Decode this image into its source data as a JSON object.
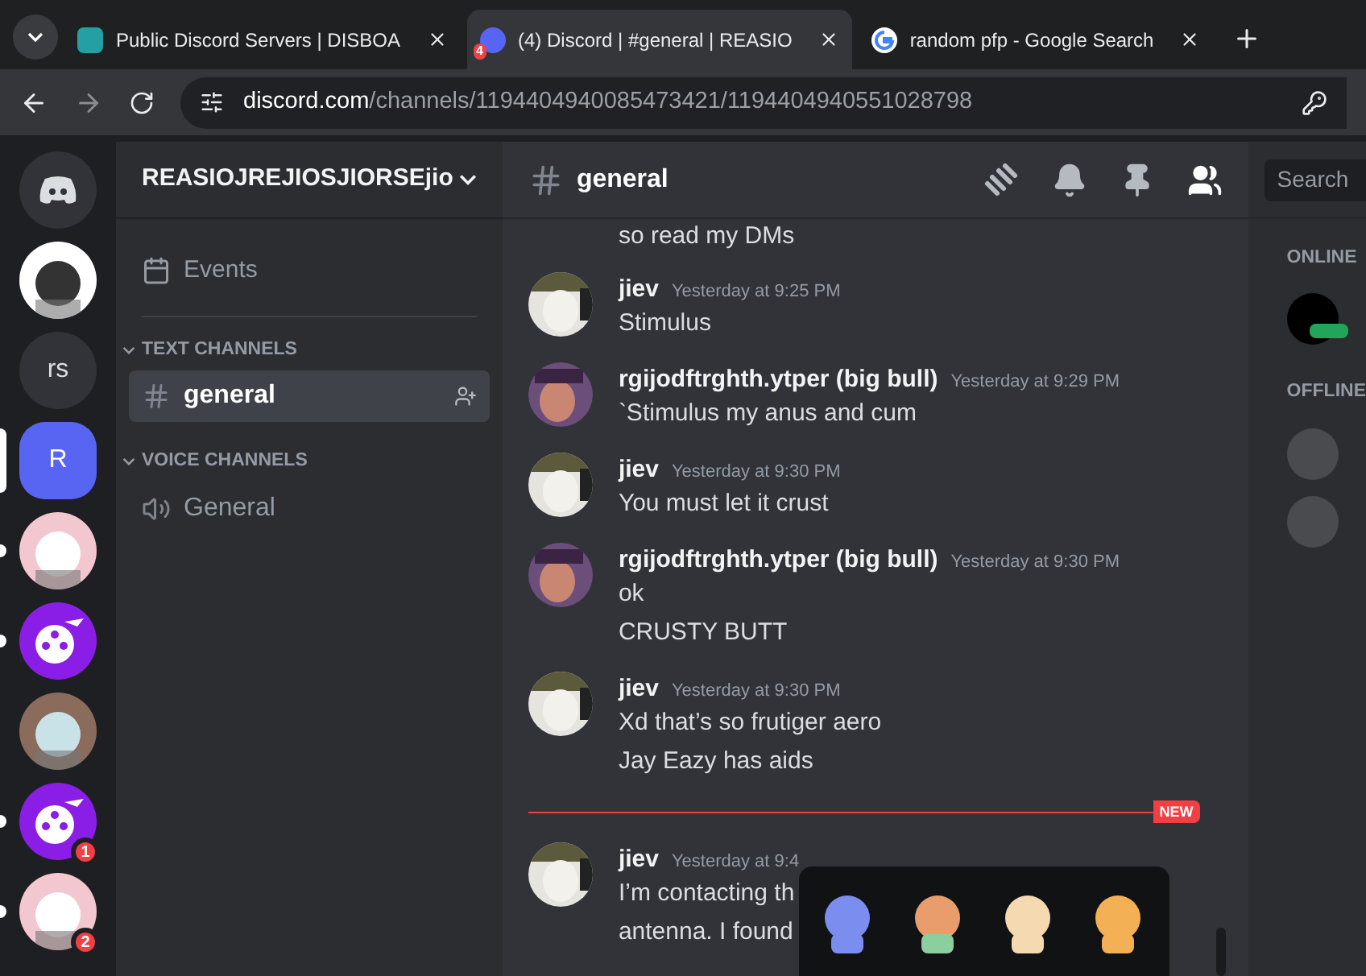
{
  "browser": {
    "tabs": [
      {
        "title": "Public Discord Servers | DISBOA",
        "selected": false
      },
      {
        "title": "(4) Discord | #general | REASIO",
        "badge": "4",
        "selected": true
      },
      {
        "title": "random pfp - Google Search",
        "selected": false
      }
    ],
    "address": {
      "domain": "discord.com",
      "path": "/channels/1194404940085473421/1194404940551028798"
    }
  },
  "servers": [
    {
      "kind": "home",
      "selected": false,
      "unread": false
    },
    {
      "kind": "picture",
      "selected": false,
      "unread": false
    },
    {
      "kind": "text",
      "label": "rs",
      "selected": false,
      "unread": false
    },
    {
      "kind": "text",
      "label": "R",
      "selected": true,
      "unread": false
    },
    {
      "kind": "picture",
      "selected": false,
      "unread": true
    },
    {
      "kind": "reel",
      "selected": false,
      "unread": true
    },
    {
      "kind": "picture",
      "selected": false,
      "unread": false
    },
    {
      "kind": "reel",
      "selected": false,
      "unread": true,
      "badge": "1"
    },
    {
      "kind": "picture",
      "selected": false,
      "unread": true,
      "badge": "2"
    }
  ],
  "server_name": "REASIOJREJIOSJIORSEjio",
  "events": "Events",
  "categories": [
    {
      "title": "TEXT CHANNELS",
      "expanded": true,
      "channels": [
        {
          "kind": "text",
          "name": "general",
          "selected": true
        }
      ]
    },
    {
      "title": "VOICE CHANNELS",
      "expanded": true,
      "channels": [
        {
          "kind": "voice",
          "name": "General",
          "selected": false
        }
      ]
    }
  ],
  "channel": {
    "name": "general",
    "search": {
      "placeholder": "Search"
    }
  },
  "messages": [
    {
      "kind": "continuation",
      "lines": [
        "so read my DMs"
      ]
    },
    {
      "kind": "message",
      "author": "jiev",
      "time": "Yesterday at 9:25 PM",
      "lines": [
        "Stimulus"
      ]
    },
    {
      "kind": "message",
      "author": "rgijodftrghth.ytper (big bull)",
      "time": "Yesterday at 9:29 PM",
      "lines": [
        "`Stimulus my anus and cum"
      ]
    },
    {
      "kind": "message",
      "author": "jiev",
      "time": "Yesterday at 9:30 PM",
      "lines": [
        "You must let it crust"
      ]
    },
    {
      "kind": "message",
      "author": "rgijodftrghth.ytper (big bull)",
      "time": "Yesterday at 9:30 PM",
      "lines": [
        "ok",
        "CRUSTY BUTT"
      ]
    },
    {
      "kind": "message",
      "author": "jiev",
      "time": "Yesterday at 9:30 PM",
      "lines": [
        "Xd that’s so frutiger aero",
        "Jay Eazy has aids"
      ]
    },
    {
      "kind": "divider",
      "label": "NEW"
    },
    {
      "kind": "message",
      "author": "jiev",
      "time": "Yesterday at 9:4",
      "lines": [
        "I’m contacting th",
        "antenna. I found"
      ]
    }
  ],
  "members": [
    {
      "title": "ONLINE",
      "people": [
        {
          "kind": "online"
        }
      ]
    },
    {
      "title": "OFFLINE",
      "people": [
        {
          "kind": "offline"
        },
        {
          "kind": "offline"
        }
      ]
    }
  ]
}
